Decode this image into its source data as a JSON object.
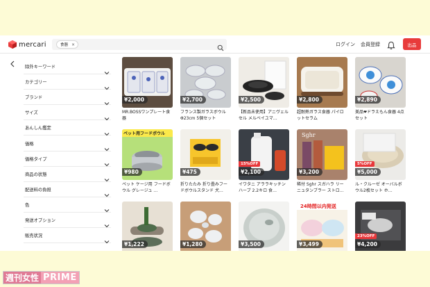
{
  "header": {
    "logo_text": "mercari",
    "search_chip": "食器",
    "chip_close": "×",
    "login": "ログイン",
    "signup": "会員登録",
    "sell": "出品"
  },
  "sidebar": {
    "filters": [
      {
        "label": "除外キーワード"
      },
      {
        "label": "カテゴリー"
      },
      {
        "label": "ブランド"
      },
      {
        "label": "サイズ"
      },
      {
        "label": "あんしん鑑定"
      },
      {
        "label": "価格"
      },
      {
        "label": "価格タイプ"
      },
      {
        "label": "商品の状態"
      },
      {
        "label": "配送料の負担"
      },
      {
        "label": "色"
      },
      {
        "label": "発送オプション"
      },
      {
        "label": "販売状況"
      }
    ]
  },
  "products": [
    {
      "price": "¥2,000",
      "title": "MR.BOSSワンプレート食器",
      "badge": ""
    },
    {
      "price": "¥2,700",
      "title": "フランス製ガラスボウル Φ23cm 5個セット",
      "badge": ""
    },
    {
      "price": "¥2,500",
      "title": "【新品未使用】アニヴェルセル メルベイユマ…",
      "badge": ""
    },
    {
      "price": "¥2,800",
      "title": "超耐熱ガラス食器 パイロットセラム",
      "badge": ""
    },
    {
      "price": "¥2,890",
      "title": "美品❤ドラえもん食器 4点セット",
      "badge": ""
    },
    {
      "price": "¥980",
      "title": "ペット ケージ用 フードボウル グレージュ …",
      "badge": ""
    },
    {
      "price": "¥475",
      "title": "折りたたみ 折り畳みフードボウルスタンド 犬…",
      "badge": ""
    },
    {
      "price": "¥2,100",
      "title": "イワタニ アララキッチンハーブ 2.2キロ 食…",
      "badge": "15%OFF"
    },
    {
      "price": "¥3,200",
      "title": "稀付 Sghr スガハラ リーニュタンブラー ストロ…",
      "badge": ""
    },
    {
      "price": "¥5,000",
      "title": "ル・クルーゼ オーバルボウル2枚セット ホ…",
      "badge": "5%OFF"
    },
    {
      "price": "¥1,222",
      "title": "",
      "badge": ""
    },
    {
      "price": "¥1,280",
      "title": "",
      "badge": ""
    },
    {
      "price": "¥3,500",
      "title": "",
      "badge": ""
    },
    {
      "price": "¥3,499",
      "title": "",
      "badge": ""
    },
    {
      "price": "¥4,200",
      "title": "",
      "badge": "23%OFF"
    }
  ],
  "image_texts": {
    "pet_banner": "ペット用フードボウル",
    "sghr": "Sghr",
    "sale_banner": "24時間以内発送"
  },
  "watermark": {
    "part1": "週刊女性",
    "part2": "PRIME"
  },
  "colors": {
    "sell_button": "#e83b3b",
    "badge": "#e8383b",
    "background": "#fdfbd6"
  }
}
